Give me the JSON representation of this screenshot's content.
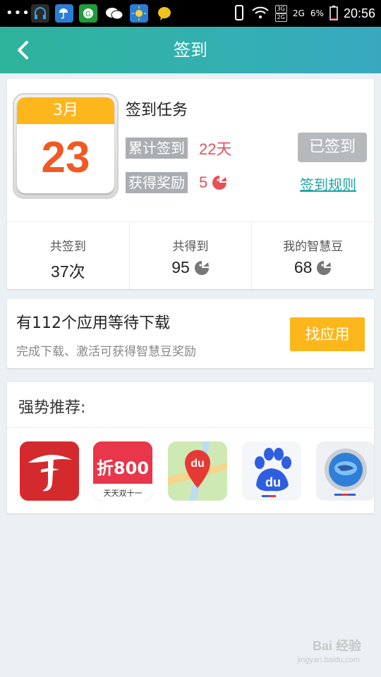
{
  "status_bar": {
    "dots": "•••",
    "network_3g": "3G",
    "network_2g": "2G",
    "battery": "6%",
    "time": "20:56",
    "icons": [
      "headset-icon",
      "weather-icon",
      "g-app-icon",
      "wechat-icon",
      "sun-icon",
      "chat-bubble-icon",
      "phone-alert-icon",
      "wifi-icon",
      "signal-icon",
      "battery-icon"
    ]
  },
  "app_bar": {
    "back_icon": "chevron-left-icon",
    "title": "签到"
  },
  "sign_card": {
    "calendar": {
      "month": "3月",
      "day": "23"
    },
    "task_title": "签到任务",
    "total_label": "累计签到",
    "total_value": "22天",
    "reward_label": "获得奖励",
    "reward_value": "5",
    "signed_button": "已签到",
    "rules_link": "签到规则",
    "summary": [
      {
        "label": "共签到",
        "value": "37次"
      },
      {
        "label": "共得到",
        "value": "95"
      },
      {
        "label": "我的智慧豆",
        "value": "68"
      }
    ]
  },
  "download_card": {
    "title": "有112个应用等待下载",
    "subtitle": "完成下载、激活可获得智慧豆奖励",
    "button": "找应用"
  },
  "recommend_card": {
    "title": "强势推荐:",
    "apps": [
      {
        "icon": "china-telecom-icon",
        "text": ""
      },
      {
        "icon": "zhe800-icon",
        "text": "折800",
        "subtext": "天天双十一"
      },
      {
        "icon": "baidu-maps-icon",
        "text": "du"
      },
      {
        "icon": "baidu-icon",
        "text": "du"
      },
      {
        "icon": "browser-globe-icon",
        "text": ""
      }
    ]
  },
  "watermark": {
    "text": "Bai 经验",
    "sub": "jingyan.baidu.com"
  },
  "colors": {
    "appbar_start": "#2eb39b",
    "appbar_end": "#38a8c0",
    "calendar_header": "#fdb71c",
    "calendar_day": "#f05a22",
    "highlight_red": "#e6505a",
    "label_gray": "#aaaeb2",
    "link_teal": "#1ba6a4",
    "button_yellow": "#fdb71c"
  }
}
